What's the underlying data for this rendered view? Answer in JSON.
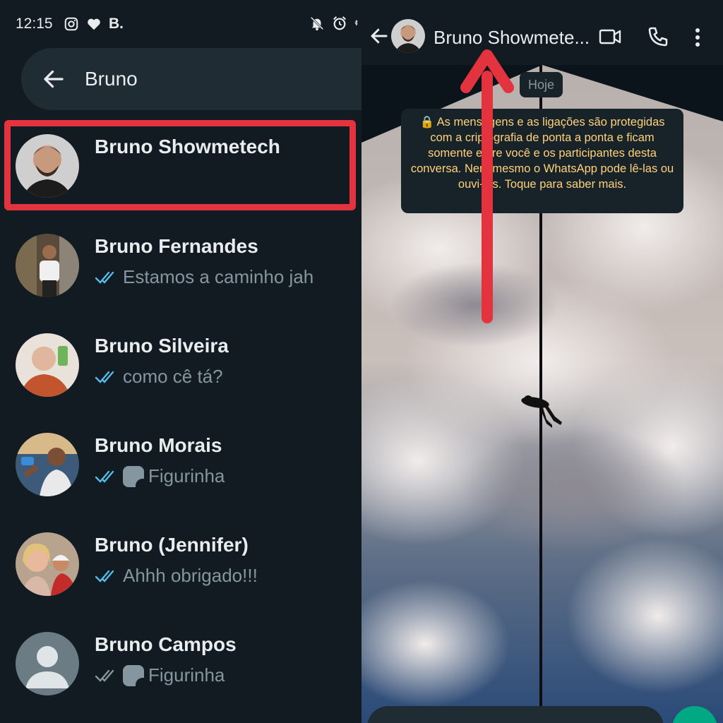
{
  "status_bar": {
    "time": "12:15",
    "b_label": "B."
  },
  "search": {
    "query": "Bruno"
  },
  "contacts": [
    {
      "name": "Bruno Showmetech",
      "message": "",
      "ticks": "none"
    },
    {
      "name": "Bruno Fernandes",
      "message": "Estamos a caminho jah",
      "ticks": "read"
    },
    {
      "name": "Bruno Silveira",
      "message": "como cê tá?",
      "ticks": "read"
    },
    {
      "name": "Bruno Morais",
      "message": "Figurinha",
      "ticks": "read",
      "sticker": true
    },
    {
      "name": "Bruno (Jennifer)",
      "message": "Ahhh obrigado!!!",
      "ticks": "read"
    },
    {
      "name": "Bruno Campos",
      "message": "Figurinha",
      "ticks": "delivered",
      "sticker": true
    }
  ],
  "chat": {
    "title": "Bruno Showmete...",
    "date_chip": "Hoje",
    "encryption_notice": "🔒 As mensagens e as ligações são protegidas com a criptografia de ponta a ponta e ficam somente entre você e os participantes desta conversa. Nem mesmo o WhatsApp pode lê-las ou ouvi-las. Toque para saber mais."
  },
  "colors": {
    "highlight": "#e2333f",
    "read_ticks": "#53bdeb",
    "accent": "#00a884",
    "notice_text": "#ffd279"
  },
  "icons": [
    "instagram-icon",
    "heart-icon",
    "mute-bell-icon",
    "alarm-icon",
    "back-arrow-icon",
    "video-call-icon",
    "phone-icon",
    "more-vert-icon",
    "double-check-icon",
    "sticker-icon",
    "default-avatar-icon",
    "lock-icon"
  ]
}
